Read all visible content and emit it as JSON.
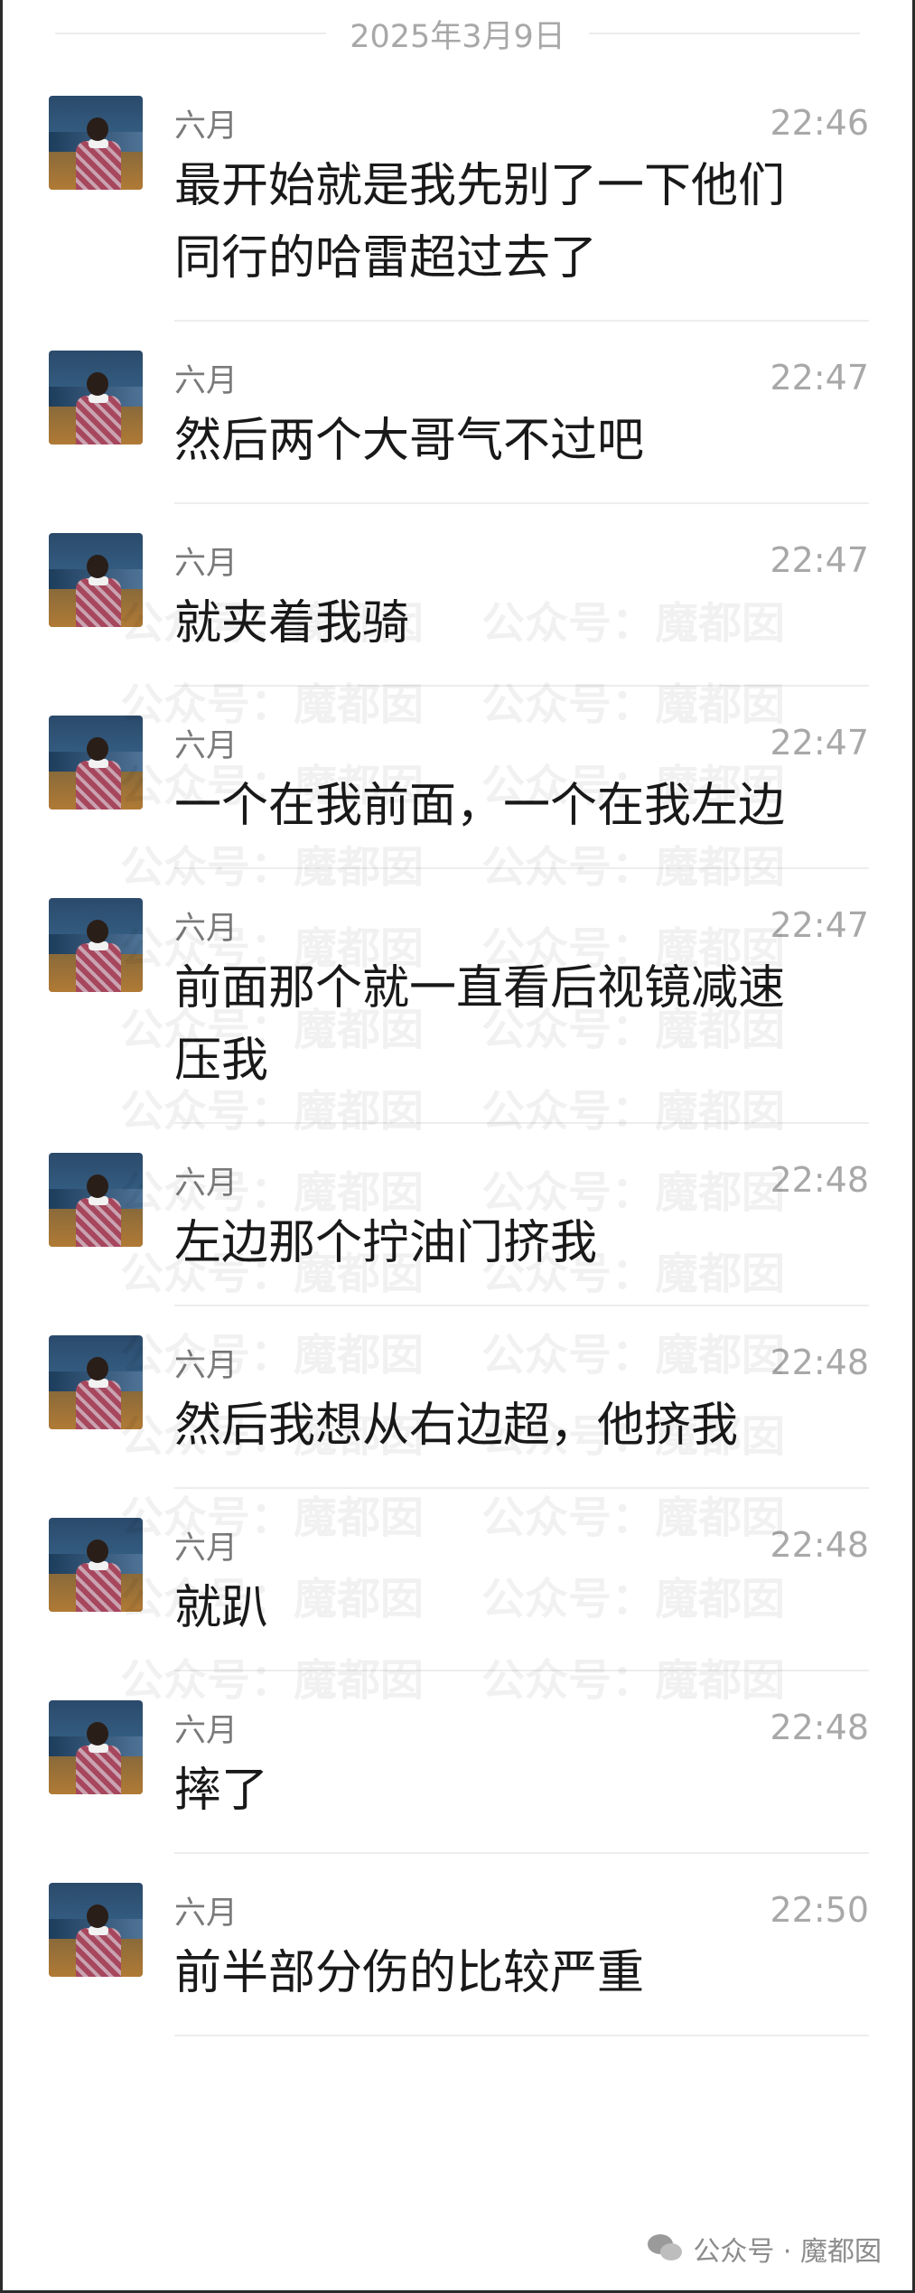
{
  "date_divider": "2025年3月9日",
  "messages": [
    {
      "sender": "六月",
      "time": "22:46",
      "text": "最开始就是我先别了一下他们\n同行的哈雷超过去了"
    },
    {
      "sender": "六月",
      "time": "22:47",
      "text": "然后两个大哥气不过吧"
    },
    {
      "sender": "六月",
      "time": "22:47",
      "text": "就夹着我骑"
    },
    {
      "sender": "六月",
      "time": "22:47",
      "text": "一个在我前面，一个在我左边"
    },
    {
      "sender": "六月",
      "time": "22:47",
      "text": "前面那个就一直看后视镜减速\n压我"
    },
    {
      "sender": "六月",
      "time": "22:48",
      "text": "左边那个拧油门挤我"
    },
    {
      "sender": "六月",
      "time": "22:48",
      "text": "然后我想从右边超，他挤我"
    },
    {
      "sender": "六月",
      "time": "22:48",
      "text": "就趴"
    },
    {
      "sender": "六月",
      "time": "22:48",
      "text": "摔了"
    },
    {
      "sender": "六月",
      "time": "22:50",
      "text": "前半部分伤的比较严重"
    }
  ],
  "watermark": {
    "text": "公众号：魔都囡",
    "color": "#000000"
  },
  "footer": {
    "label": "公众号 · 魔都囡",
    "icon": "wechat-icon"
  },
  "colors": {
    "background": "#ffffff",
    "meta_text": "#a8a8a8",
    "message_text": "#191919",
    "separator": "#ededed"
  }
}
